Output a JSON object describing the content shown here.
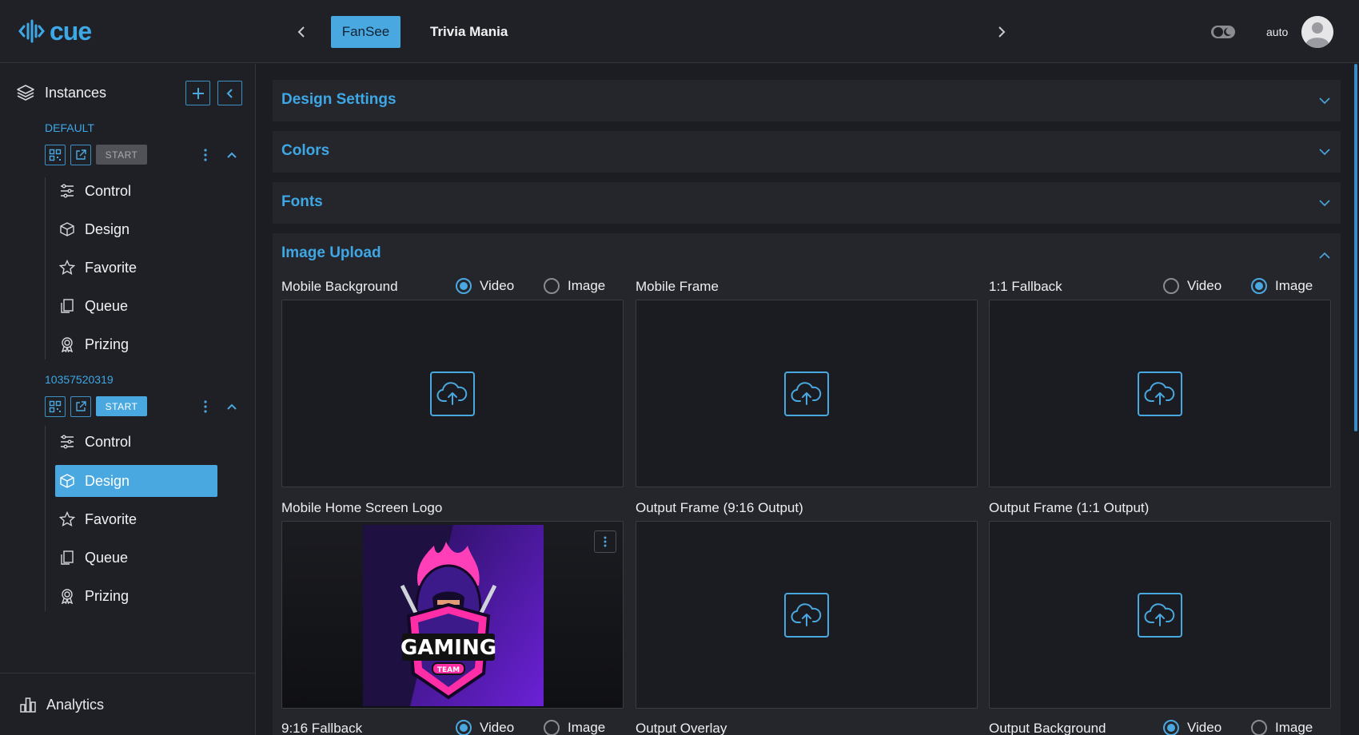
{
  "header": {
    "logo_text": "cue",
    "tabs": [
      "FanSee",
      "Trivia Mania"
    ],
    "auto_label": "auto",
    "icons": [
      "logo-icon",
      "chevron-left-icon",
      "chevron-right-icon",
      "theme-toggle-icon",
      "avatar-icon"
    ]
  },
  "sidebar": {
    "heading": "Instances",
    "instances": [
      {
        "title": "DEFAULT",
        "start_label": "START",
        "items": [
          "Control",
          "Design",
          "Favorite",
          "Queue",
          "Prizing"
        ]
      },
      {
        "title": "10357520319",
        "start_label": "START",
        "items": [
          "Control",
          "Design",
          "Favorite",
          "Queue",
          "Prizing"
        ],
        "active_item": "Design"
      }
    ],
    "footer_label": "Analytics"
  },
  "main": {
    "sections": [
      "Design Settings",
      "Colors",
      "Fonts",
      "Image Upload"
    ],
    "fields": [
      {
        "label": "Mobile Background",
        "radios": [
          "Video",
          "Image"
        ],
        "selected": "Video"
      },
      {
        "label": "Mobile Frame"
      },
      {
        "label": "1:1 Fallback",
        "radios": [
          "Video",
          "Image"
        ],
        "selected": "Image"
      },
      {
        "label": "Mobile Home Screen Logo",
        "image_text": "GAMING",
        "image_subtext": "TEAM"
      },
      {
        "label": "Output Frame (9:16 Output)"
      },
      {
        "label": "Output Frame (1:1 Output)"
      },
      {
        "label": "9:16 Fallback",
        "radios": [
          "Video",
          "Image"
        ],
        "selected": "Video"
      },
      {
        "label": "Output Overlay"
      },
      {
        "label": "Output Background",
        "radios": [
          "Video",
          "Image"
        ],
        "selected": "Video"
      }
    ]
  },
  "colors": {
    "accent": "#4aa8e0",
    "background": "#1c1d22",
    "panel": "#25262b"
  }
}
